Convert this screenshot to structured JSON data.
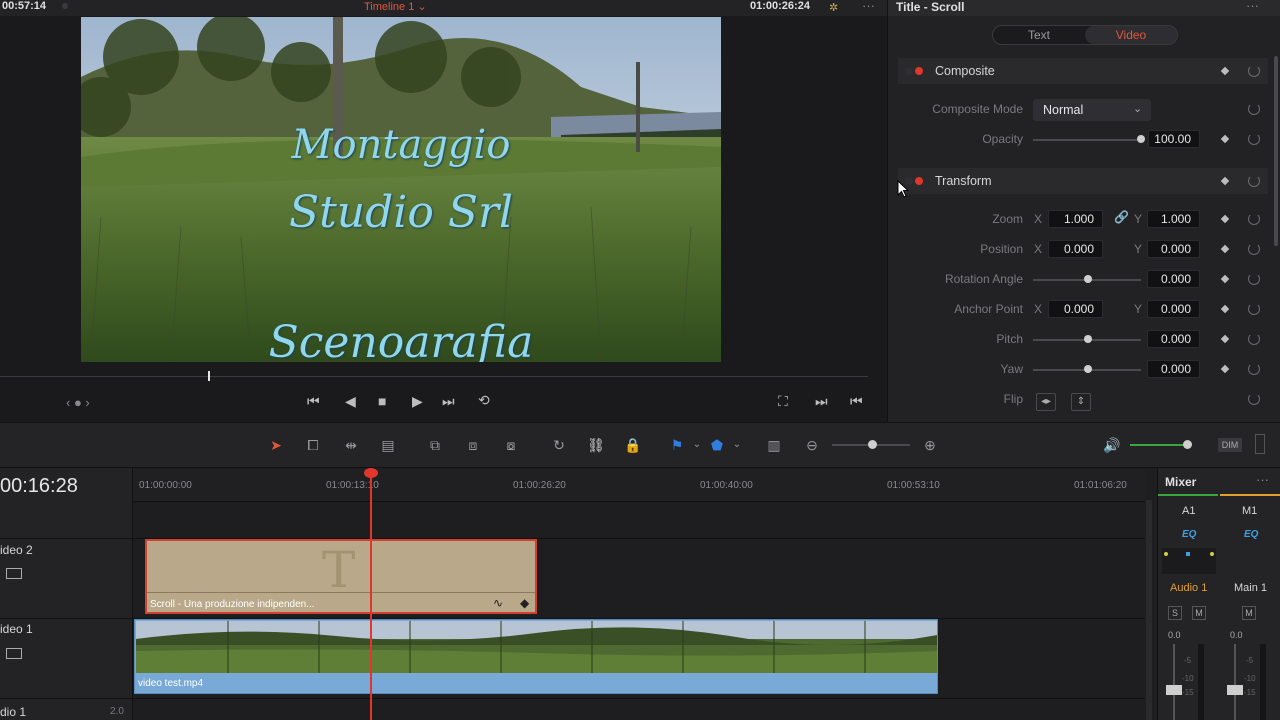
{
  "viewer": {
    "left_timecode": "00:57:14",
    "timeline_name": "Timeline 1",
    "right_timecode": "01:00:26:24",
    "title_lines": [
      "Montaggio",
      "Studio Srl",
      "Scenoarafia"
    ]
  },
  "inspector": {
    "title": "Title - Scroll",
    "tabs": [
      "Text",
      "Video"
    ],
    "active_tab": "Video",
    "composite": {
      "header": "Composite",
      "mode_label": "Composite Mode",
      "mode_value": "Normal",
      "opacity_label": "Opacity",
      "opacity_value": "100.00",
      "opacity_level": 1.0
    },
    "transform": {
      "header": "Transform",
      "zoom_label": "Zoom",
      "zoom_x": "1.000",
      "zoom_y": "1.000",
      "position_label": "Position",
      "position_x": "0.000",
      "position_y": "0.000",
      "rotation_label": "Rotation Angle",
      "rotation_value": "0.000",
      "anchor_label": "Anchor Point",
      "anchor_x": "0.000",
      "anchor_y": "0.000",
      "pitch_label": "Pitch",
      "pitch_value": "0.000",
      "yaw_label": "Yaw",
      "yaw_value": "0.000",
      "flip_label": "Flip",
      "x_label": "X",
      "y_label": "Y"
    }
  },
  "timeline": {
    "current_timecode": "00:16:28",
    "ruler": [
      "01:00:00:00",
      "01:00:13:10",
      "01:00:26:20",
      "01:00:40:00",
      "01:00:53:10",
      "01:01:06:20"
    ],
    "tracks": {
      "video2": "ideo 2",
      "video1": "ideo 1",
      "audio1": "dio 1",
      "audio1_level": "2.0"
    },
    "title_clip": "Scroll - Una produzione indipenden...",
    "title_clip_letter": "T",
    "video_clip": "video test.mp4"
  },
  "mixer": {
    "title": "Mixer",
    "channels": [
      "A1",
      "M1"
    ],
    "eq": "EQ",
    "audio_name": "Audio 1",
    "main_name": "Main 1",
    "solo": "S",
    "mute": "M",
    "level_a": "0.0",
    "level_m": "0.0",
    "scale": [
      "-5",
      "-10",
      "-15"
    ],
    "colors": {
      "audio": "#e0a030",
      "main": "#c8c8c8",
      "accent": "#ff6a4d"
    }
  }
}
